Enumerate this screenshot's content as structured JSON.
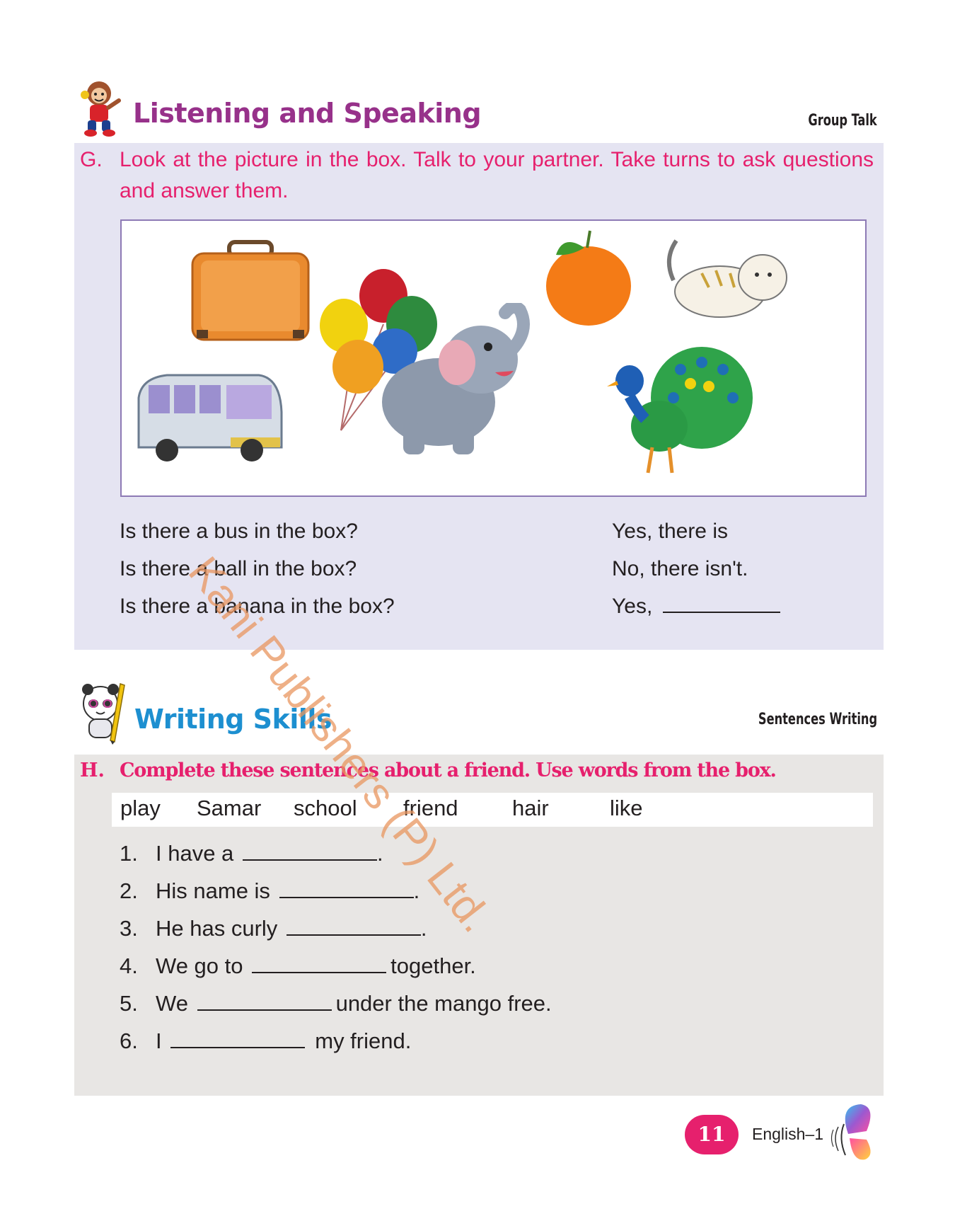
{
  "listening": {
    "title": "Listening and Speaking",
    "tag": "Group Talk",
    "letter": "G.",
    "instruction": "Look at the picture in the box. Talk to your partner. Take turns to ask questions and answer them.",
    "questions": [
      "Is there a bus in the box?",
      "Is there a ball in the box?",
      "Is there a banana in the box?"
    ],
    "answers": [
      "Yes, there is",
      "No, there isn't.",
      "Yes,"
    ]
  },
  "writing": {
    "title": "Writing Skills",
    "tag": "Sentences Writing",
    "letter": "H.",
    "instruction": "Complete these sentences about a friend. Use words from the box.",
    "words": [
      "play",
      "Samar",
      "school",
      "friend",
      "hair",
      "like"
    ],
    "items": [
      {
        "num": "1.",
        "before": "I have a",
        "after": "."
      },
      {
        "num": "2.",
        "before": "His name is",
        "after": "."
      },
      {
        "num": "3.",
        "before": "He has curly",
        "after": "."
      },
      {
        "num": "4.",
        "before": "We go to",
        "after": "together."
      },
      {
        "num": "5.",
        "before": "We",
        "after": "under the mango free."
      },
      {
        "num": "6.",
        "before": "I",
        "after": "my friend."
      }
    ]
  },
  "watermark": "Kani Publishers (P) Ltd.",
  "footer": {
    "page_number": "11",
    "book": "English–1"
  },
  "colors": {
    "listening_title": "#97318a",
    "writing_title": "#1d8fd0",
    "instruction_pink": "#e6206d",
    "panel_g": "#e5e4f2",
    "panel_h": "#e8e6e4"
  }
}
